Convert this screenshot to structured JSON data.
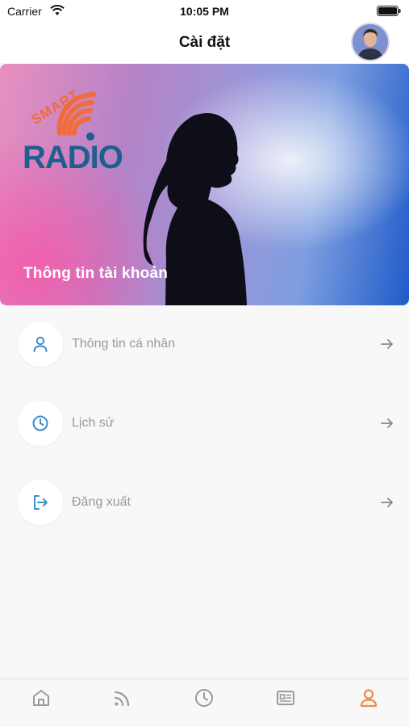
{
  "status_bar": {
    "carrier": "Carrier",
    "time": "10:05 PM"
  },
  "header": {
    "title": "Cài đặt"
  },
  "banner": {
    "logo_text_top": "SMART",
    "logo_text_main": "RADIO",
    "caption": "Thông tin tài khoản"
  },
  "menu": {
    "items": [
      {
        "label": "Thông tin cá nhân",
        "icon": "person-icon"
      },
      {
        "label": "Lịch sử",
        "icon": "clock-icon"
      },
      {
        "label": "Đăng xuất",
        "icon": "logout-icon"
      }
    ]
  },
  "tab_bar": {
    "tabs": [
      {
        "icon": "home-icon",
        "active": false
      },
      {
        "icon": "feed-icon",
        "active": false
      },
      {
        "icon": "clock-icon",
        "active": false
      },
      {
        "icon": "news-icon",
        "active": false
      },
      {
        "icon": "profile-icon",
        "active": true
      }
    ]
  },
  "colors": {
    "accent": "#3a8fd0",
    "tab_active": "#f08a4b",
    "tab_inactive": "#9a9a9a",
    "logo_orange": "#f26b3a",
    "logo_blue": "#1f5f8f"
  }
}
